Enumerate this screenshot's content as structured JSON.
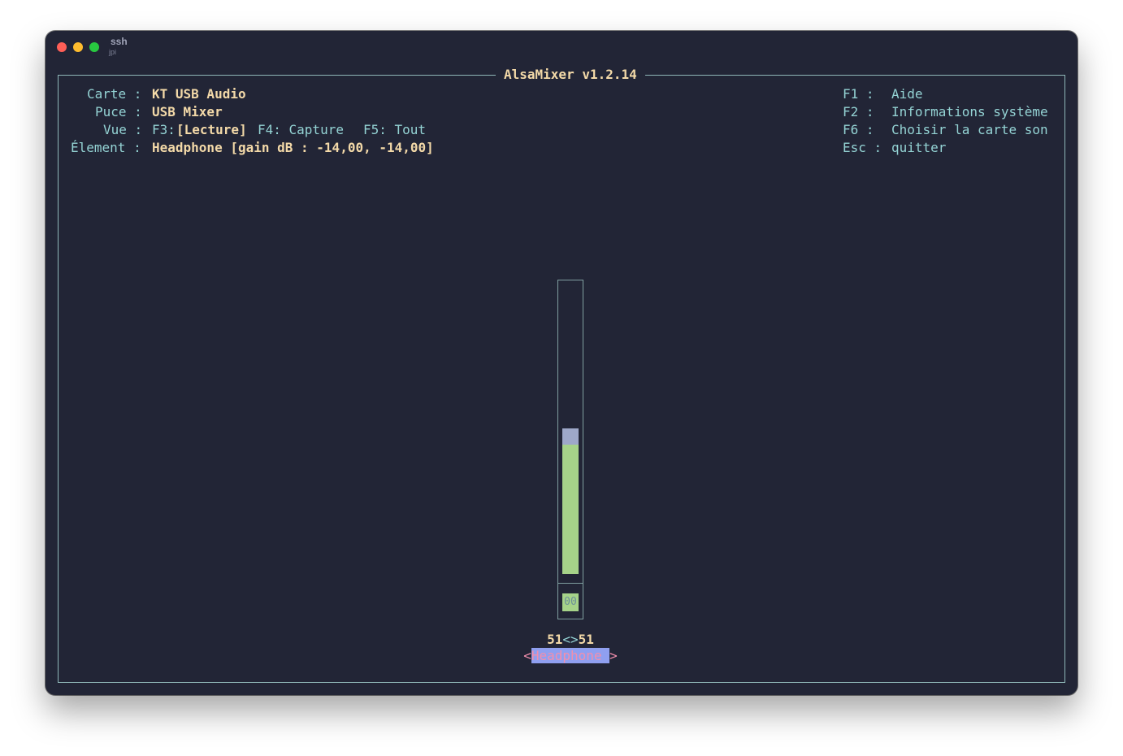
{
  "titlebar": {
    "title": "ssh",
    "subtitle": "jpi"
  },
  "app": {
    "title": "AlsaMixer v1.2.14"
  },
  "info": {
    "card_label": "Carte :",
    "card_value": "KT USB Audio",
    "chip_label": "Puce :",
    "chip_value": "USB Mixer",
    "view_label": "Vue :",
    "view_f3_key": "F3:",
    "view_f3_value": "[Lecture]",
    "view_f4": "F4: Capture",
    "view_f5": "F5: Tout",
    "element_label": "Élement :",
    "element_value": "Headphone [gain dB : -14,00, -14,00]"
  },
  "help": {
    "items": [
      {
        "key": "F1 :",
        "label": "Aide"
      },
      {
        "key": "F2 :",
        "label": "Informations système"
      },
      {
        "key": "F6 :",
        "label": "Choisir la carte son"
      },
      {
        "key": "Esc :",
        "label": "quitter"
      }
    ]
  },
  "control": {
    "name": "Headphone",
    "mute_text": "00",
    "left_volume": "51",
    "separator": "<>",
    "right_volume": "51",
    "level_percent": 51,
    "colors": {
      "fill": "#a6d389",
      "peak": "#9ea8c9",
      "selected_bg": "#8f9ff0",
      "selected_fg": "#f28fad"
    }
  }
}
